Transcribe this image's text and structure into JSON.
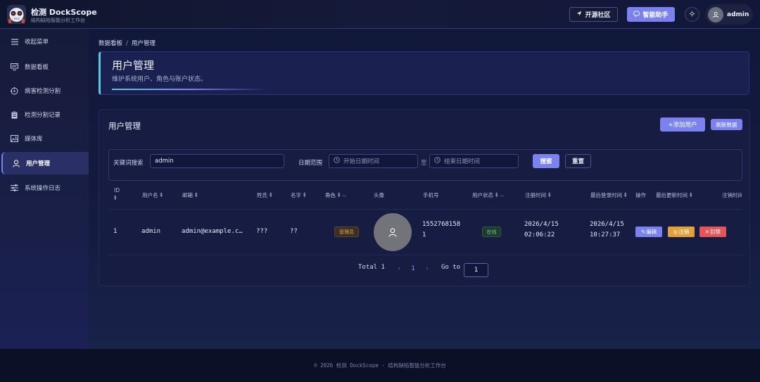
{
  "brand": {
    "title": "检测 DockScope",
    "subtitle": "结构缺陷智能分析工作台"
  },
  "header": {
    "community_label": "开源社区",
    "assistant_label": "智能助手",
    "user_name": "admin"
  },
  "sidebar": {
    "items": [
      {
        "label": "收起菜单",
        "icon": "menu-icon"
      },
      {
        "label": "数据看板",
        "icon": "dashboard-icon"
      },
      {
        "label": "病害检测分割",
        "icon": "target-icon"
      },
      {
        "label": "检测分割记录",
        "icon": "clipboard-icon"
      },
      {
        "label": "媒体库",
        "icon": "image-icon"
      },
      {
        "label": "用户管理",
        "icon": "user-icon",
        "active": true
      },
      {
        "label": "系统操作日志",
        "icon": "sliders-icon"
      }
    ]
  },
  "breadcrumb": {
    "root": "数据看板",
    "separator": "/",
    "current": "用户管理"
  },
  "hero": {
    "title": "用户管理",
    "subtitle": "维护系统用户、角色与账户状态。"
  },
  "card": {
    "title": "用户管理",
    "add_label": "+添加用户",
    "refresh_label": "刷新数据"
  },
  "filters": {
    "keyword_label": "关键词搜索",
    "keyword_value": "admin",
    "date_label": "日期范围",
    "start_placeholder": "开始日期时间",
    "to_label": "至",
    "end_placeholder": "结束日期时间",
    "search_label": "搜索",
    "reset_label": "重置"
  },
  "table": {
    "columns": {
      "id": "ID",
      "username": "用户名",
      "email": "邮箱",
      "last_name": "姓氏",
      "first_name": "名字",
      "role": "角色",
      "avatar": "头像",
      "phone": "手机号",
      "status": "用户状态",
      "register_time": "注册时间",
      "last_login": "最后登录时间",
      "actions": "操作",
      "last_update": "最后更新时间",
      "cancel_time": "注销时间"
    },
    "rows": [
      {
        "id": "1",
        "username": "admin",
        "email": "admin@example.c…",
        "last_name": "???",
        "first_name": "??",
        "role": "管理员",
        "phone_line1": "1552768158",
        "phone_line2": "1",
        "status": "在线",
        "register_date": "2026/4/15",
        "register_time": "02:06:22",
        "login_date": "2026/4/15",
        "login_time": "10:27:37",
        "edit_label": "编辑",
        "cancel_label": "注销",
        "ban_label": "封禁"
      }
    ]
  },
  "pagination": {
    "total_label": "Total 1",
    "current_page": "1",
    "goto_label": "Go to",
    "goto_value": "1"
  },
  "footer": {
    "text": "© 2026 检测 DockScope · 结构缺陷智能分析工作台"
  },
  "colors": {
    "accent": "#7b82f0",
    "warning": "#e0a238",
    "danger": "#e4555b",
    "success": "#5fd08a"
  }
}
